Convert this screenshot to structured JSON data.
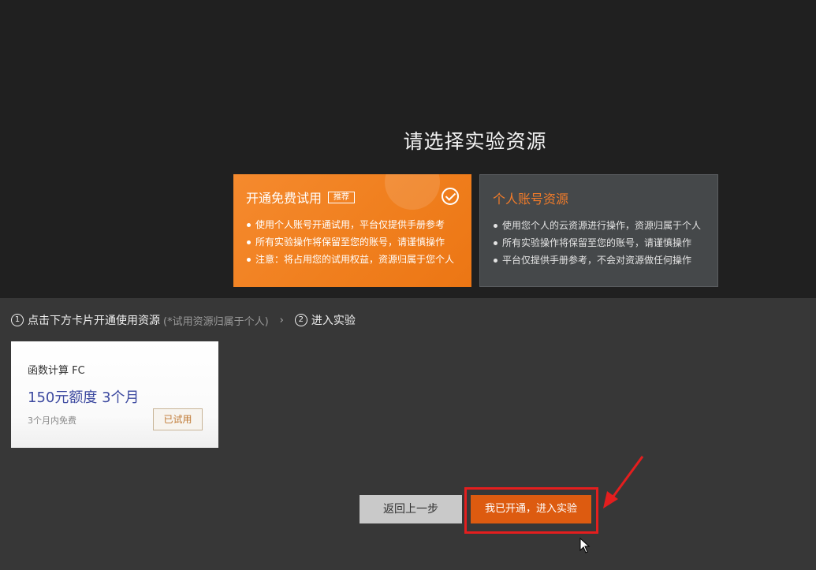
{
  "page": {
    "title": "请选择实验资源"
  },
  "options": {
    "free_trial": {
      "title": "开通免费试用",
      "badge": "推荐",
      "bullets": [
        "使用个人账号开通试用，平台仅提供手册参考",
        "所有实验操作将保留至您的账号，请谨慎操作",
        "注意：将占用您的试用权益，资源归属于您个人"
      ]
    },
    "personal_account": {
      "title": "个人账号资源",
      "bullets": [
        "使用您个人的云资源进行操作，资源归属于个人",
        "所有实验操作将保留至您的账号，请谨慎操作",
        "平台仅提供手册参考，不会对资源做任何操作"
      ]
    }
  },
  "steps": {
    "step1_num": "1",
    "step1_label": "点击下方卡片开通使用资源",
    "step1_note": "(*试用资源归属于个人)",
    "chevron": "›",
    "step2_num": "2",
    "step2_label": "进入实验"
  },
  "product": {
    "name": "函数计算 FC",
    "offer": "150元额度 3个月",
    "sub": "3个月内免费",
    "status_button": "已试用"
  },
  "actions": {
    "back": "返回上一步",
    "enter": "我已开通，进入实验"
  },
  "colors": {
    "accent_orange": "#f07f1e",
    "enter_button": "#dd5b10",
    "highlight_red": "#e41e1e",
    "offer_blue": "#3d4aa0"
  }
}
